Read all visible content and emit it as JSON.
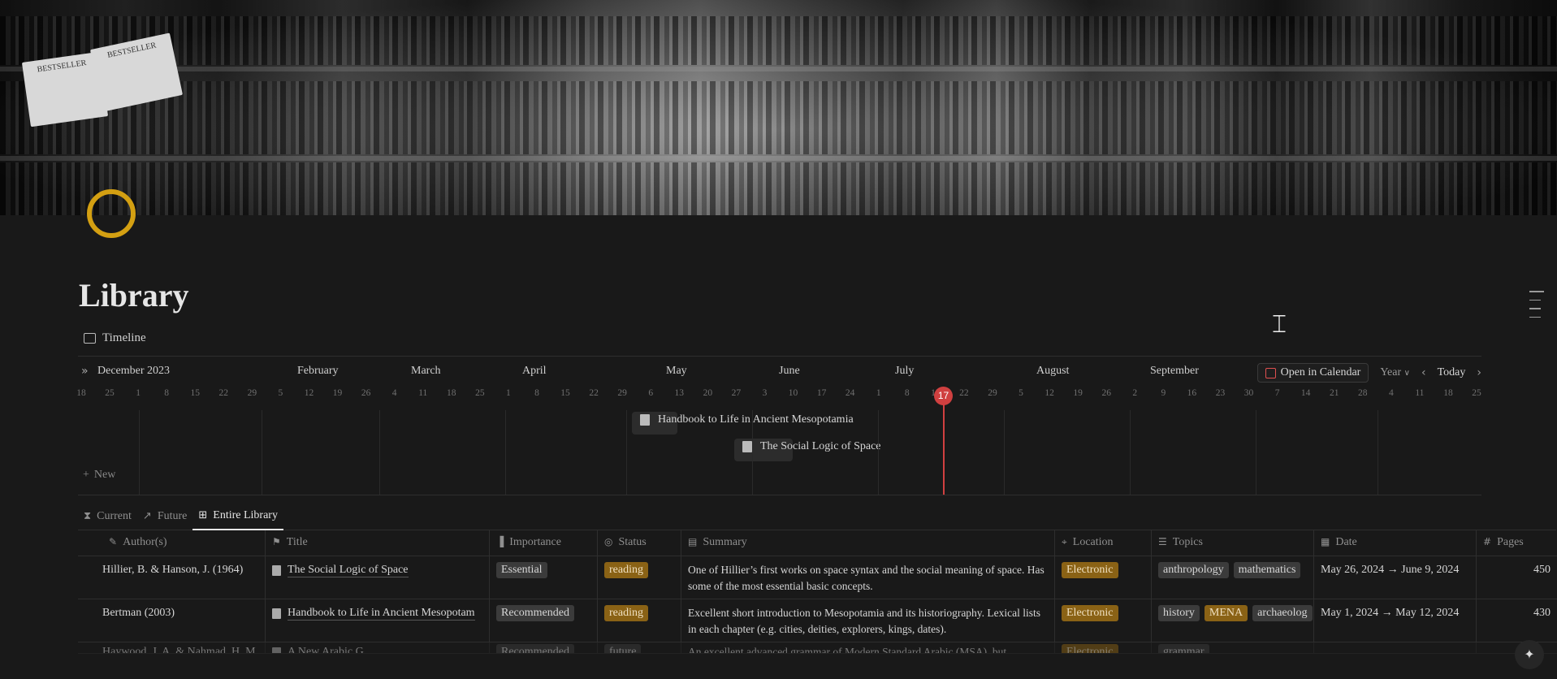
{
  "page": {
    "title": "Library",
    "view_label": "Timeline",
    "cover_cards": [
      "BESTSELLER",
      "BESTSELLER"
    ]
  },
  "timeline": {
    "months": [
      "December 2023",
      "February",
      "March",
      "April",
      "May",
      "June",
      "July",
      "August",
      "September"
    ],
    "days": [
      "18",
      "25",
      "1",
      "8",
      "15",
      "22",
      "29",
      "5",
      "12",
      "19",
      "26",
      "4",
      "11",
      "18",
      "25",
      "1",
      "8",
      "15",
      "22",
      "29",
      "6",
      "13",
      "20",
      "27",
      "3",
      "10",
      "17",
      "24",
      "1",
      "8",
      "15",
      "22",
      "29",
      "5",
      "12",
      "19",
      "26",
      "2",
      "9",
      "16",
      "23",
      "30",
      "7",
      "14",
      "21",
      "28",
      "4",
      "11",
      "18",
      "25"
    ],
    "today": "17",
    "items": [
      {
        "title": "Handbook to Life in Ancient Mesopotamia"
      },
      {
        "title": "The Social Logic of Space"
      }
    ],
    "new_label": "New",
    "controls": {
      "open_calendar": "Open in Calendar",
      "zoom": "Year",
      "today": "Today"
    }
  },
  "tabs": [
    {
      "label": "Current",
      "icon": "hourglass-icon"
    },
    {
      "label": "Future",
      "icon": "telescope-icon"
    },
    {
      "label": "Entire Library",
      "icon": "table-icon"
    }
  ],
  "table": {
    "columns": [
      "Author(s)",
      "Title",
      "Importance",
      "Status",
      "Summary",
      "Location",
      "Topics",
      "Date",
      "Pages"
    ],
    "rows": [
      {
        "author": "Hillier, B. & Hanson, J. (1964)",
        "title": "The Social Logic of Space",
        "importance": "Essential",
        "status": "reading",
        "summary": "One of Hillier’s first works on space syntax and the social meaning of space. Has some of the most essential basic concepts.",
        "location": "Electronic",
        "topics": [
          "anthropology",
          "mathematics"
        ],
        "date": "May 26, 2024 → June 9, 2024",
        "pages": "450"
      },
      {
        "author": "Bertman (2003)",
        "title": "Handbook to Life in Ancient Mesopotam",
        "importance": "Recommended",
        "status": "reading",
        "summary": "Excellent short introduction to Mesopotamia and its historiography. Lexical lists in each chapter (e.g. cities, deities, explorers, kings, dates).",
        "location": "Electronic",
        "topics": [
          "history",
          "MENA",
          "archaeolog"
        ],
        "date": "May 1, 2024 → May 12, 2024",
        "pages": "430"
      },
      {
        "author": "Haywood, J. A. & Nahmad, H. M.",
        "title": "A New Arabic G",
        "importance": "Recommended",
        "status": "future",
        "summary": "An excellent advanced grammar of Modern Standard Arabic (MSA), but",
        "location": "Electronic",
        "topics": [
          "grammar"
        ],
        "date": "",
        "pages": ""
      }
    ]
  },
  "colors": {
    "background": "#191919",
    "accent_gold": "#d4a012",
    "tag_gold": "#8a6215",
    "tag_grey": "#3b3b3b",
    "today_red": "#d04040"
  }
}
